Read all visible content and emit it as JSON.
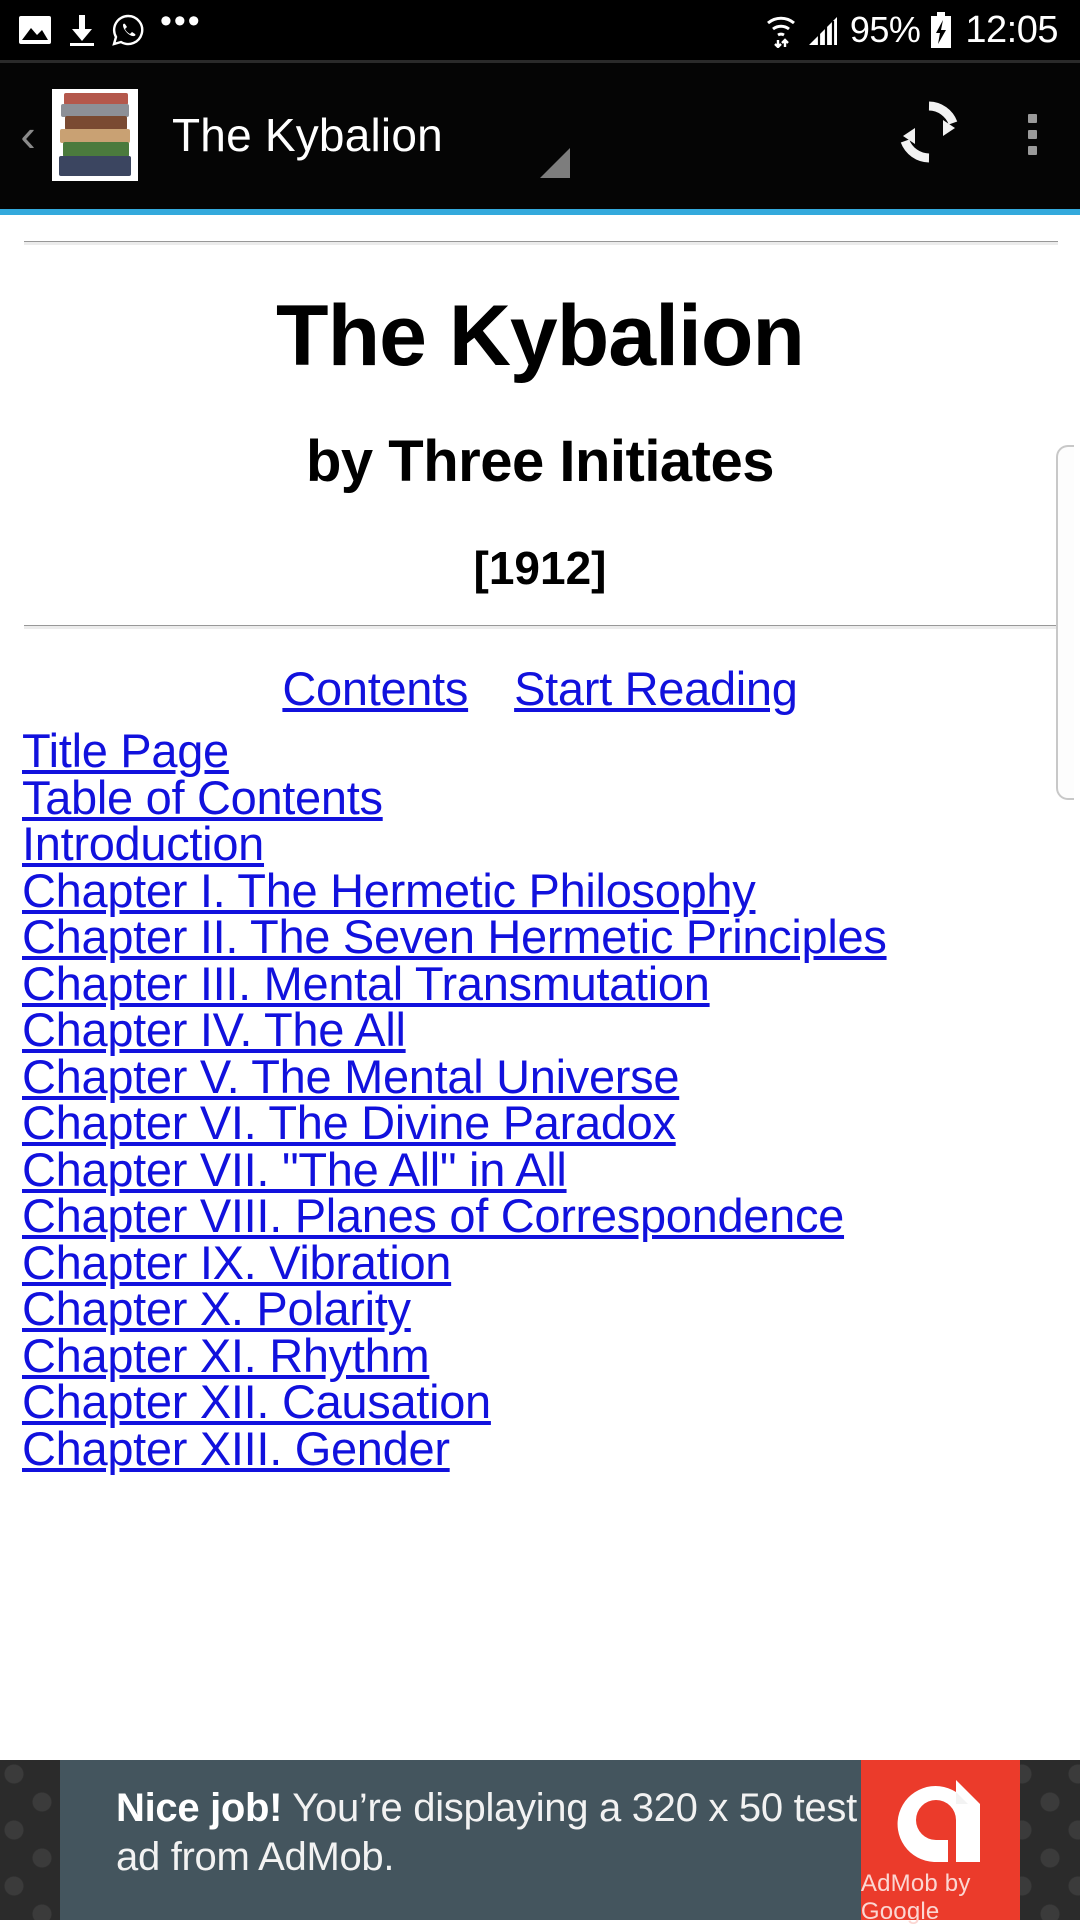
{
  "status_bar": {
    "left_icons": [
      "image-icon",
      "download-icon",
      "whatsapp-icon",
      "more-icon"
    ],
    "ellipsis": "•••",
    "wifi_icon": "wifi-icon",
    "signal_icon": "signal-icon",
    "battery_percent": "95%",
    "battery_icon": "battery-charging-icon",
    "time": "12:05"
  },
  "app_bar": {
    "back_label": "‹",
    "app_icon": "book-stack-icon",
    "title": "The Kybalion",
    "refresh_icon": "refresh-icon",
    "overflow_icon": "overflow-menu-icon"
  },
  "page": {
    "title": "The Kybalion",
    "author": "by Three Initiates",
    "year": "[1912]",
    "top_links": [
      {
        "label": "Contents"
      },
      {
        "label": "Start Reading"
      }
    ],
    "toc": [
      {
        "label": "Title Page"
      },
      {
        "label": "Table of Contents"
      },
      {
        "label": "Introduction"
      },
      {
        "label": "Chapter I. The Hermetic Philosophy"
      },
      {
        "label": "Chapter II. The Seven Hermetic Principles"
      },
      {
        "label": "Chapter III. Mental Transmutation"
      },
      {
        "label": "Chapter IV. The All"
      },
      {
        "label": "Chapter V. The Mental Universe"
      },
      {
        "label": "Chapter VI. The Divine Paradox"
      },
      {
        "label": "Chapter VII. \"The All\" in All"
      },
      {
        "label": "Chapter VIII. Planes of Correspondence"
      },
      {
        "label": "Chapter IX. Vibration"
      },
      {
        "label": "Chapter X. Polarity"
      },
      {
        "label": "Chapter XI. Rhythm"
      },
      {
        "label": "Chapter XII. Causation"
      },
      {
        "label": "Chapter XIII. Gender"
      }
    ]
  },
  "ad": {
    "headline": "Nice job!",
    "body": " You’re displaying a 320 x 50 test ad from AdMob.",
    "brand": "AdMob by Google",
    "brand_color": "#eb3b2b",
    "panel_color": "#44555e"
  },
  "colors": {
    "link": "#1111dd",
    "progress": "#33a9dc",
    "appbar": "#050505",
    "statusbar": "#000000"
  }
}
